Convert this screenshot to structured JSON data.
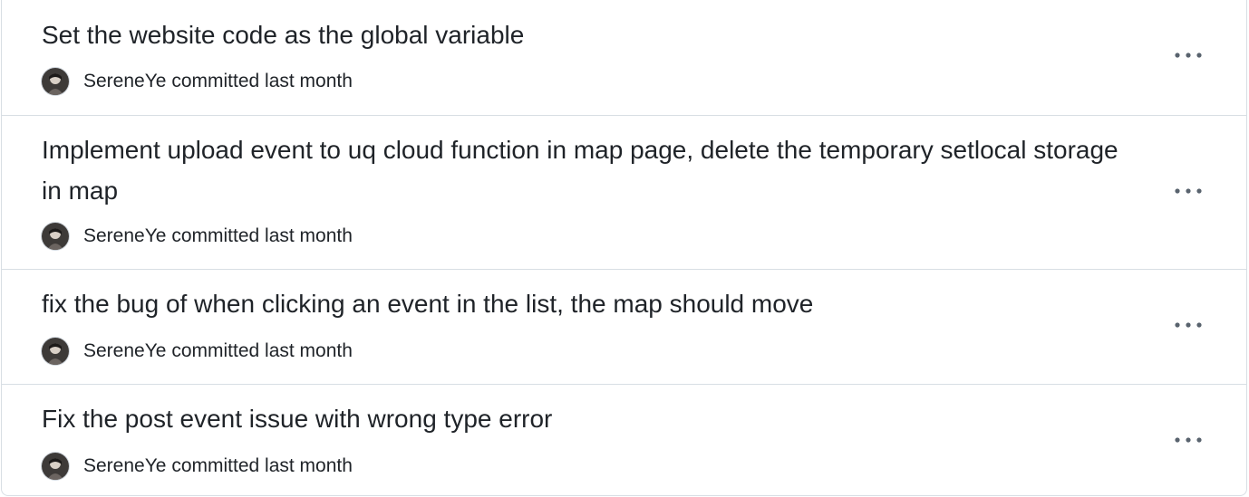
{
  "commits": [
    {
      "title": "Set the website code as the global variable",
      "author": "SereneYe",
      "action": "committed",
      "time": "last month"
    },
    {
      "title": "Implement upload event to uq cloud function in map page, delete the temporary setlocal storage in map",
      "author": "SereneYe",
      "action": "committed",
      "time": "last month"
    },
    {
      "title": "fix the bug of when clicking an event in the list, the map should move",
      "author": "SereneYe",
      "action": "committed",
      "time": "last month"
    },
    {
      "title": "Fix the post event issue with wrong type error",
      "author": "SereneYe",
      "action": "committed",
      "time": "last month"
    }
  ],
  "icons": {
    "avatar": "user-avatar",
    "more": "kebab-horizontal-icon"
  },
  "colors": {
    "text": "#1f2328",
    "muted": "#59636e",
    "border": "#d8dee4"
  }
}
